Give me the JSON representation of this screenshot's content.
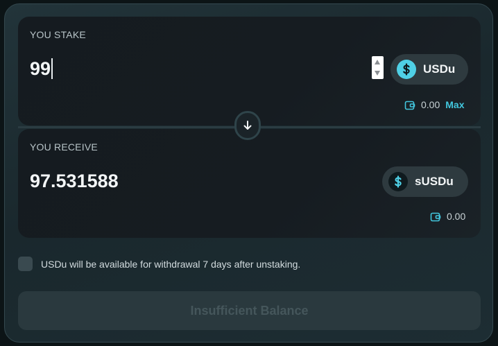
{
  "stake": {
    "label": "YOU STAKE",
    "amount": "99",
    "token": "USDu",
    "balance": "0.00",
    "max_label": "Max"
  },
  "receive": {
    "label": "YOU RECEIVE",
    "amount": "97.531588",
    "token": "sUSDu",
    "balance": "0.00"
  },
  "notice": "USDu will be available for withdrawal 7 days after unstaking.",
  "submit_label": "Insufficient Balance",
  "colors": {
    "accent": "#42c6dd",
    "usdu_icon_bg": "#4fd0e6",
    "susdu_icon_bg": "#0f1a1e"
  },
  "icons": {
    "stake_token": "dollar-icon",
    "receive_token": "dollar-icon",
    "wallet": "wallet-icon",
    "swap": "arrow-down-icon"
  }
}
